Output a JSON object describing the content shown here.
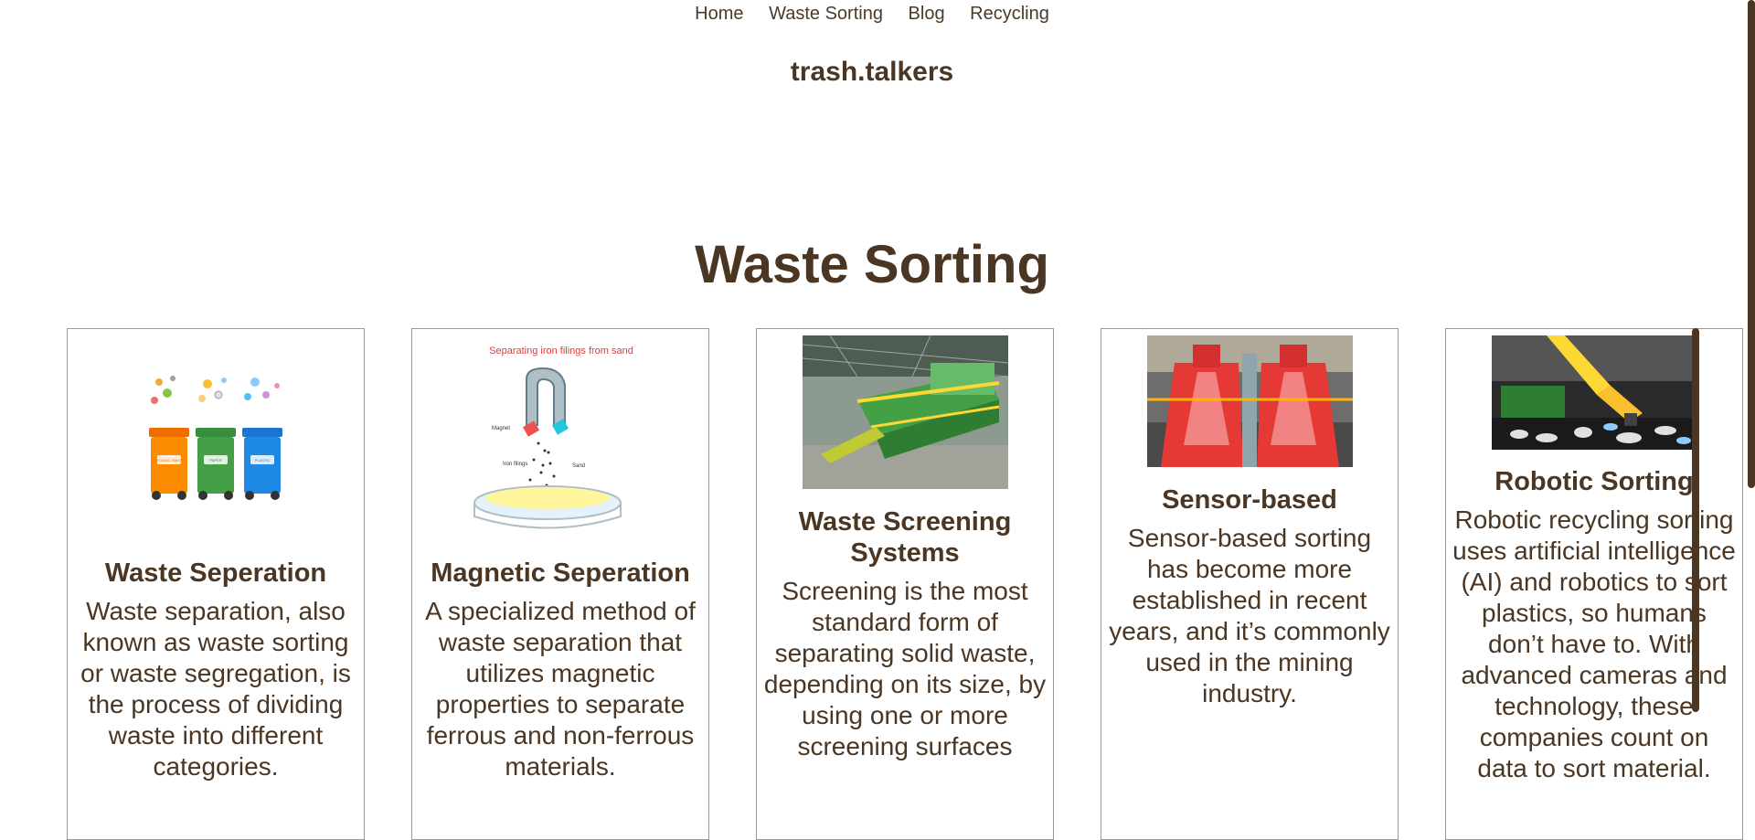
{
  "nav": {
    "items": [
      "Home",
      "Waste Sorting",
      "Blog",
      "Recycling"
    ]
  },
  "brand": "trash.talkers",
  "page_title": "Waste Sorting",
  "cards": [
    {
      "title": "Waste Seperation",
      "text": "Waste separation, also known as waste sorting or waste segregation, is the process of dividing waste into different categories.",
      "image": {
        "bin_labels": [
          "ORGANIC WASTE",
          "PAPER",
          "PLASTIC"
        ]
      }
    },
    {
      "title": "Magnetic Seperation",
      "text": "A specialized method of waste separation that utilizes magnetic properties to separate ferrous and non-ferrous materials.",
      "image": {
        "caption": "Separating iron filings from sand",
        "labels": [
          "Magnet",
          "Iron filings",
          "Sand"
        ]
      }
    },
    {
      "title": "Waste Screening Systems",
      "text": "Screening is the most standard form of separating solid waste, depending on its size, by using one or more screening surfaces"
    },
    {
      "title": "Sensor-based",
      "text": "Sensor-based sorting has become more established in recent years, and it’s commonly used in the mining industry."
    },
    {
      "title": "Robotic Sorting",
      "text": "Robotic recycling sorting uses artificial intelligence (AI) and robotics to sort plastics, so humans don’t have to. With advanced cameras and technology, these companies count on data to sort material."
    }
  ],
  "colors": {
    "text": "#4a3623",
    "card_border": "#9a9a9a",
    "scrollbar": "#4a3623"
  }
}
